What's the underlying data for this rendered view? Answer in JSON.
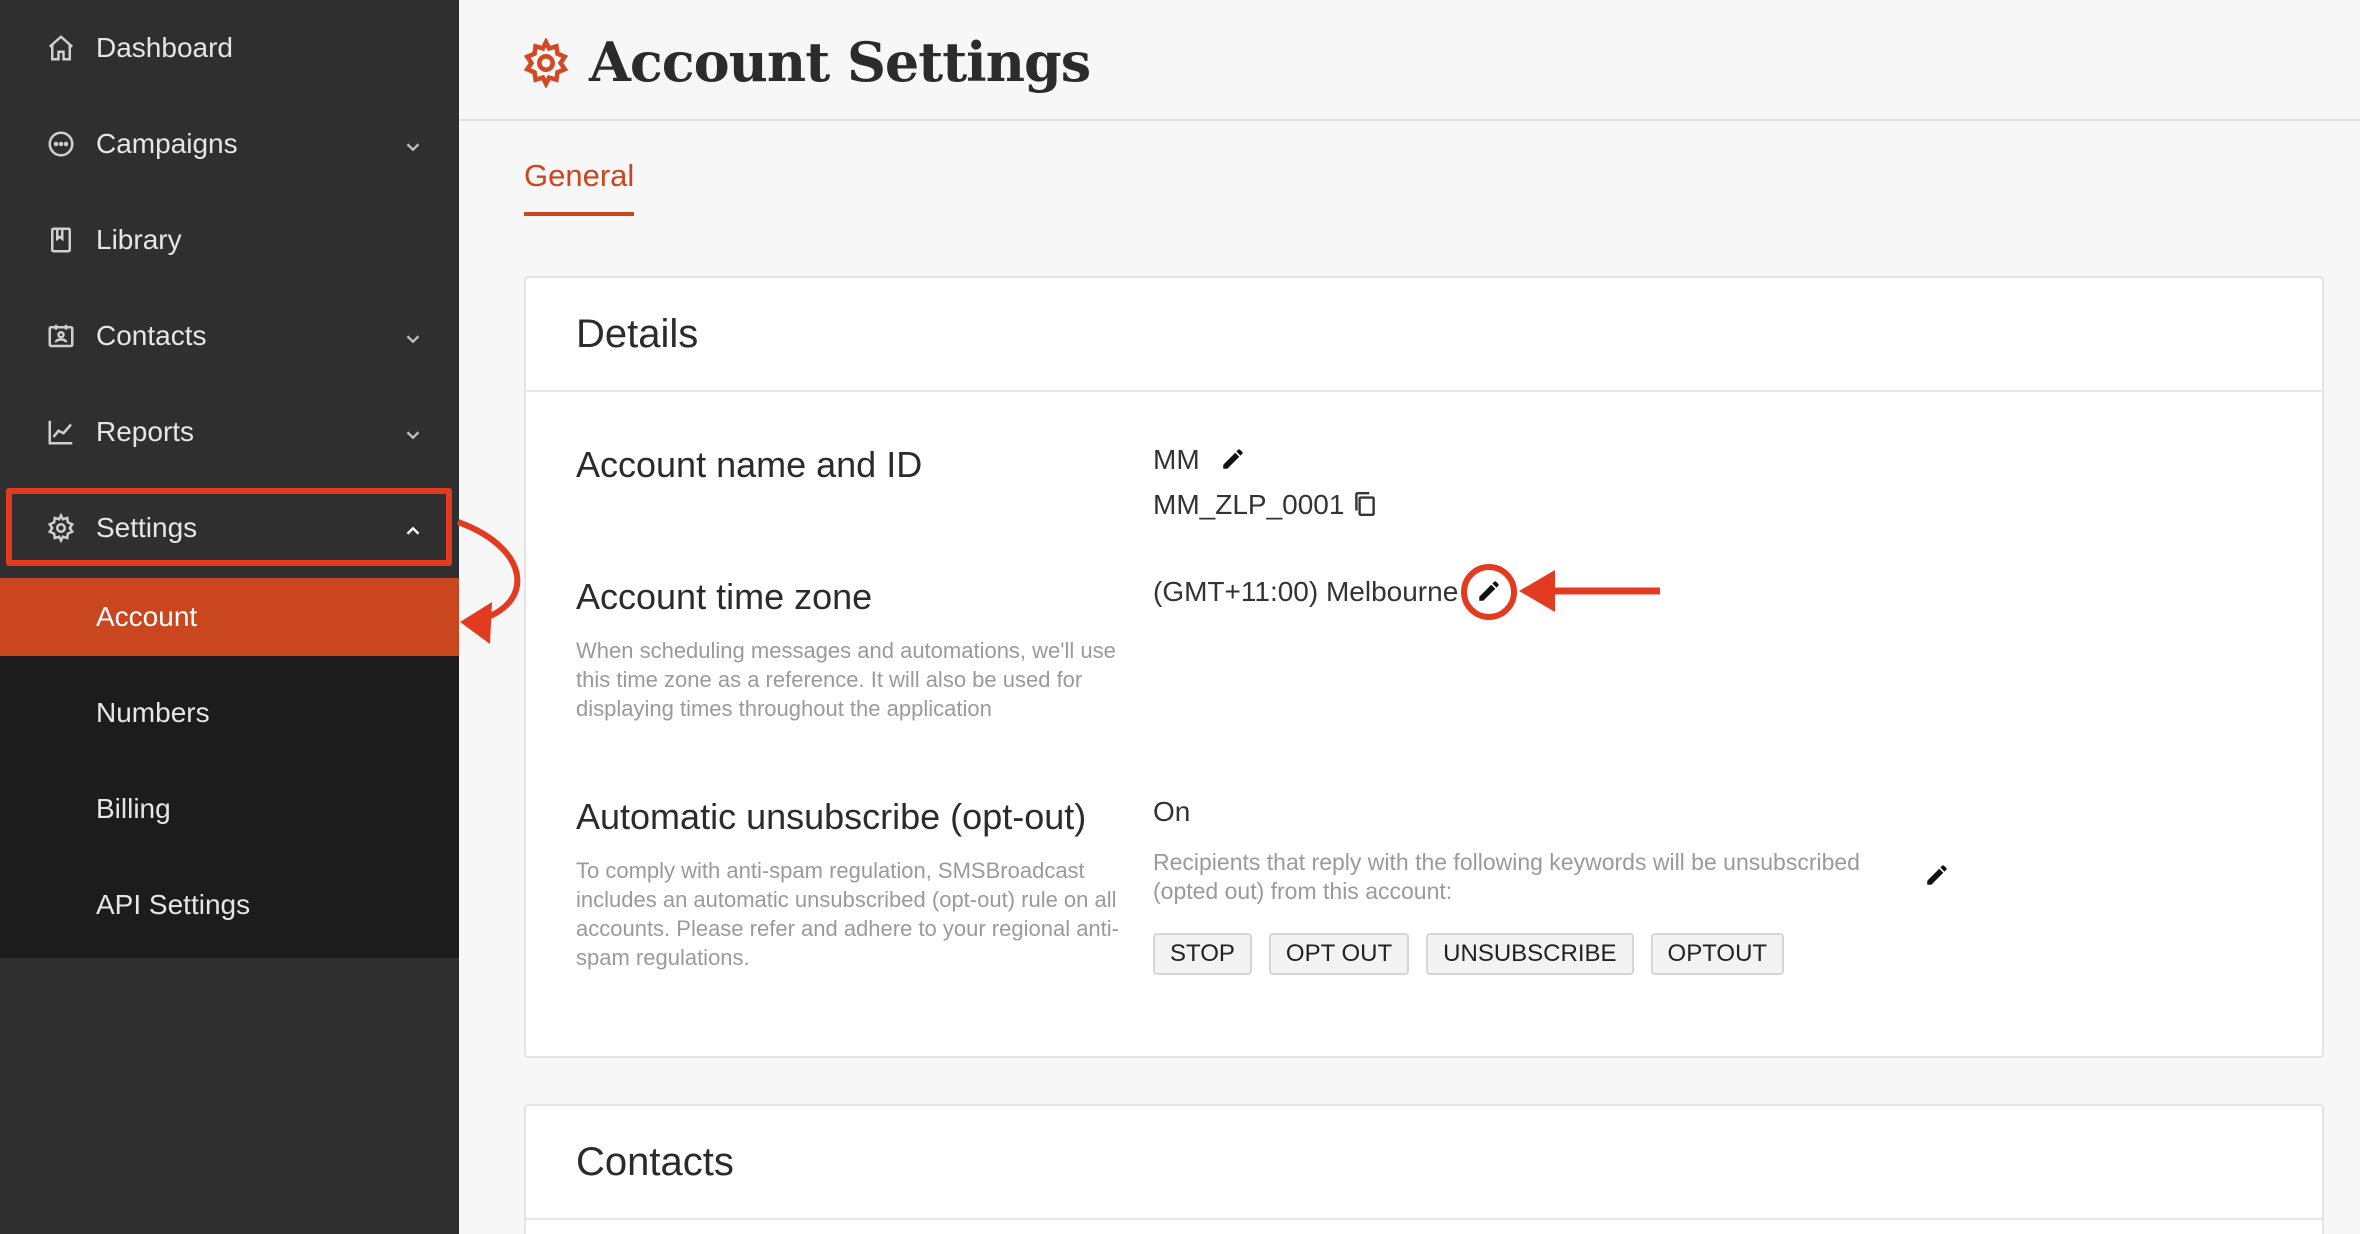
{
  "sidebar": {
    "items": [
      {
        "label": "Dashboard",
        "icon": "home-icon"
      },
      {
        "label": "Campaigns",
        "icon": "chat-icon"
      },
      {
        "label": "Library",
        "icon": "book-icon"
      },
      {
        "label": "Contacts",
        "icon": "contacts-icon"
      },
      {
        "label": "Reports",
        "icon": "chart-icon"
      },
      {
        "label": "Settings",
        "icon": "gear-icon"
      }
    ],
    "settings_sub": [
      "Account",
      "Numbers",
      "Billing",
      "API Settings"
    ],
    "active_sub": "Account"
  },
  "header": {
    "title": "Account Settings"
  },
  "tabs": [
    {
      "label": "General",
      "active": true
    }
  ],
  "details": {
    "title": "Details",
    "account_name": {
      "label": "Account name and ID",
      "name": "MM",
      "id": "MM_ZLP_0001"
    },
    "timezone": {
      "label": "Account time zone",
      "description": "When scheduling messages and automations, we'll use this time zone as a reference. It will also be used for displaying times throughout the application",
      "value": "(GMT+11:00) Melbourne"
    },
    "unsubscribe": {
      "label": "Automatic unsubscribe (opt-out)",
      "description": "To comply with anti-spam regulation, SMSBroadcast includes an automatic unsubscribed (opt-out) rule on all accounts. Please refer and adhere to your regional anti-spam regulations.",
      "status": "On",
      "keywords_note": "Recipients that reply with the following keywords will be unsubscribed (opted out) from this account:",
      "keywords": [
        "STOP",
        "OPT OUT",
        "UNSUBSCRIBE",
        "OPTOUT"
      ]
    }
  },
  "contacts_card": {
    "title": "Contacts"
  },
  "colors": {
    "accent": "#c9461f",
    "sidebar_bg": "#2f2f2f",
    "subnav_bg": "#1c1c1c",
    "annotation": "#e23b22"
  }
}
